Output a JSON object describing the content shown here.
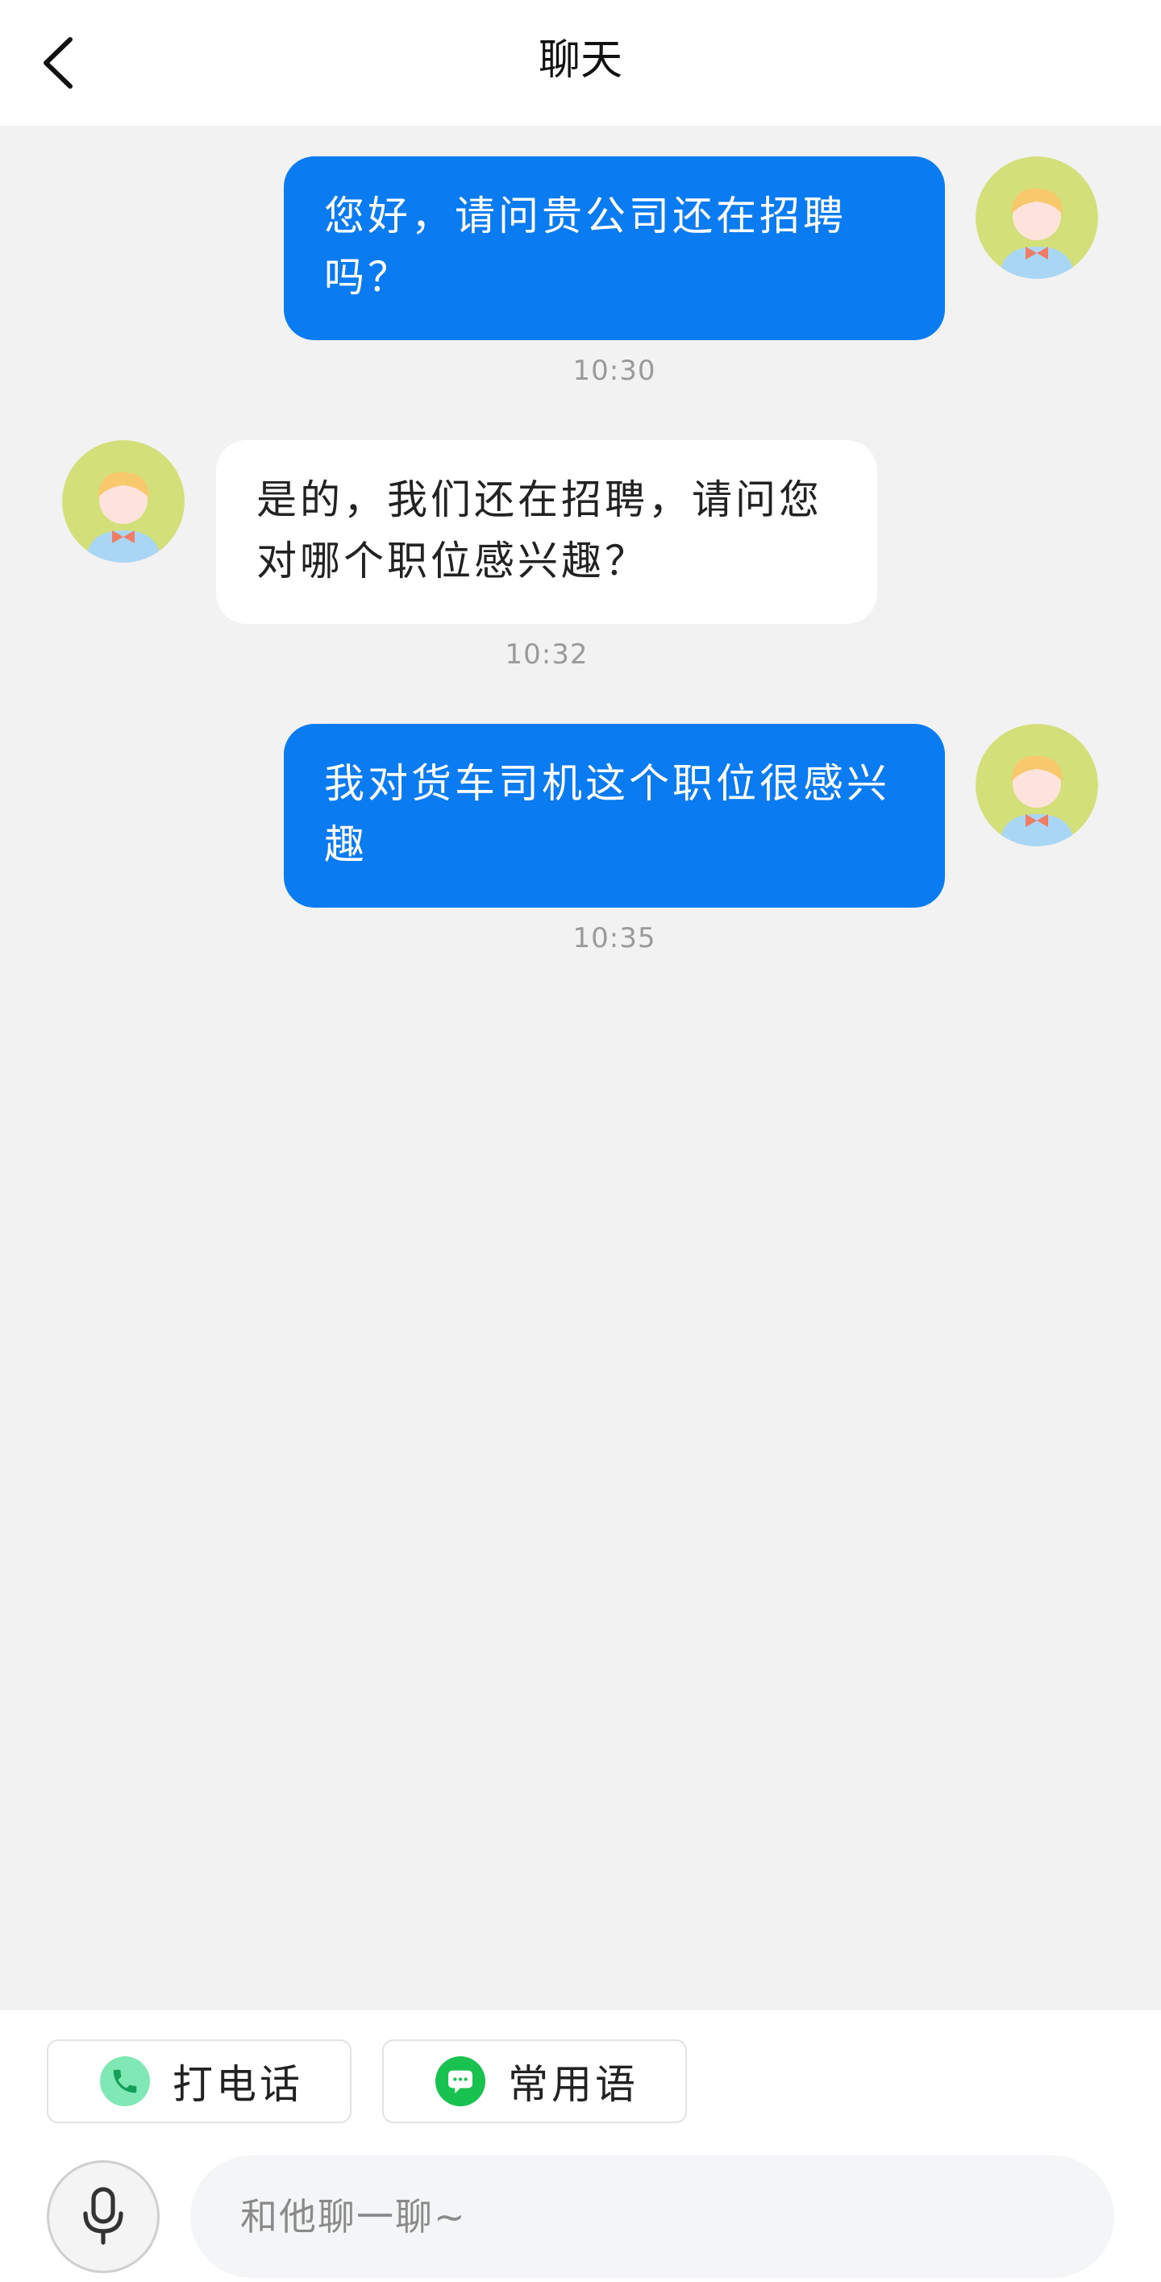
{
  "header": {
    "title": "聊天",
    "back_icon": "chevron-left-icon"
  },
  "messages": [
    {
      "side": "me",
      "text": "您好，请问贵公司还在招聘吗？",
      "time": "10:30"
    },
    {
      "side": "other",
      "text": "是的，我们还在招聘，请问您对哪个职位感兴趣？",
      "time": "10:32"
    },
    {
      "side": "me",
      "text": "我对货车司机这个职位很感兴趣",
      "time": "10:35"
    }
  ],
  "quick_actions": {
    "call": {
      "label": "打电话",
      "icon": "phone-icon"
    },
    "phrases": {
      "label": "常用语",
      "icon": "chat-bubble-icon"
    }
  },
  "composer": {
    "placeholder": "和他聊一聊~",
    "mic_icon": "microphone-icon"
  },
  "colors": {
    "accent": "#0a7bf0",
    "background": "#f2f2f3",
    "call_icon_bg": "#7fe8b4",
    "phrases_icon_bg": "#19c24e"
  }
}
